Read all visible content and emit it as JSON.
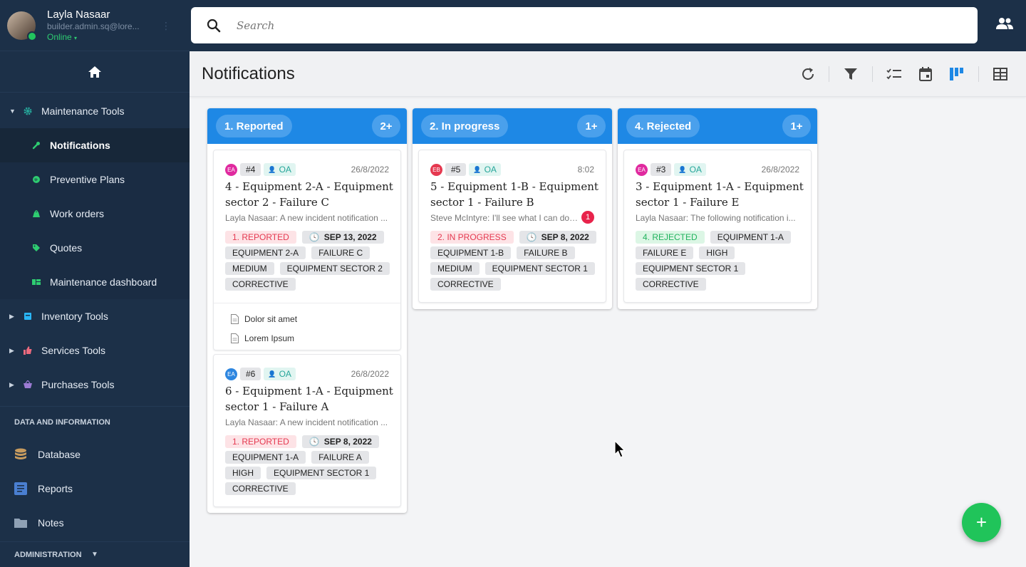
{
  "user": {
    "name": "Layla Nasaar",
    "email": "builder.admin.sq@lore...",
    "status": "Online"
  },
  "search": {
    "placeholder": "Search"
  },
  "sidebar": {
    "groups": [
      {
        "label": "Maintenance Tools",
        "color": "#26a69a",
        "expanded": true,
        "items": [
          {
            "label": "Notifications",
            "icon": "wrench-icon",
            "color": "#2ecc71",
            "active": true
          },
          {
            "label": "Preventive Plans",
            "icon": "globe-icon",
            "color": "#2ecc71"
          },
          {
            "label": "Work orders",
            "icon": "bag-icon",
            "color": "#2ecc71"
          },
          {
            "label": "Quotes",
            "icon": "tag-icon",
            "color": "#2ecc71"
          },
          {
            "label": "Maintenance dashboard",
            "icon": "dashboard-icon",
            "color": "#2ecc71"
          }
        ]
      },
      {
        "label": "Inventory Tools",
        "color": "#29b6f6",
        "icon": "inventory-icon"
      },
      {
        "label": "Services Tools",
        "color": "#ec6a7e",
        "icon": "thumb-icon"
      },
      {
        "label": "Purchases Tools",
        "color": "#9c7bd4",
        "icon": "basket-icon"
      }
    ],
    "section_title": "DATA AND INFORMATION",
    "data_items": [
      {
        "label": "Database",
        "icon": "database-icon",
        "color": "#c79b5e"
      },
      {
        "label": "Reports",
        "icon": "reports-icon",
        "color": "#4a7fd1"
      },
      {
        "label": "Notes",
        "icon": "folder-icon",
        "color": "#8fa1b5"
      }
    ],
    "admin_title": "ADMINISTRATION"
  },
  "header": {
    "title": "Notifications",
    "view_active": "kanban"
  },
  "board": {
    "columns": [
      {
        "title": "1. Reported",
        "count": "2+",
        "cards": [
          {
            "initials": "EA",
            "initials_color": "#e02a9f",
            "id": "#4",
            "assignee": "OA",
            "date": "26/8/2022",
            "title": "4 - Equipment 2-A - Equipment sector 2 - Failure C",
            "preview": "Layla Nasaar: A new incident notification ...",
            "status": "1. REPORTED",
            "due": "SEP 13, 2022",
            "tags": [
              "EQUIPMENT 2-A",
              "FAILURE C",
              "MEDIUM",
              "EQUIPMENT SECTOR 2",
              "CORRECTIVE"
            ],
            "attachments": [
              "Dolor sit amet",
              "Lorem Ipsum"
            ]
          },
          {
            "initials": "EA",
            "initials_color": "#2d86e0",
            "id": "#6",
            "assignee": "OA",
            "date": "26/8/2022",
            "title": "6 - Equipment 1-A - Equipment sector 1 - Failure A",
            "preview": "Layla Nasaar: A new incident notification ...",
            "status": "1. REPORTED",
            "due": "SEP 8, 2022",
            "tags": [
              "EQUIPMENT 1-A",
              "FAILURE A",
              "HIGH",
              "EQUIPMENT SECTOR 1",
              "CORRECTIVE"
            ]
          }
        ]
      },
      {
        "title": "2. In progress",
        "count": "1+",
        "cards": [
          {
            "initials": "EB",
            "initials_color": "#e53950",
            "id": "#5",
            "assignee": "OA",
            "date": "8:02",
            "title": "5 - Equipment 1-B - Equipment sector 1 - Failure B",
            "preview": "Steve McIntyre: I'll see what I can do. ...",
            "unread": "1",
            "status": "2. IN PROGRESS",
            "due": "SEP 8, 2022",
            "tags": [
              "EQUIPMENT 1-B",
              "FAILURE B",
              "MEDIUM",
              "EQUIPMENT SECTOR 1",
              "CORRECTIVE"
            ]
          }
        ]
      },
      {
        "title": "4. Rejected",
        "count": "1+",
        "cards": [
          {
            "initials": "EA",
            "initials_color": "#e02a9f",
            "id": "#3",
            "assignee": "OA",
            "date": "26/8/2022",
            "title": "3 - Equipment 1-A - Equipment sector 1 - Failure E",
            "preview": "Layla Nasaar: The following notification i...",
            "status": "4. REJECTED",
            "tags": [
              "EQUIPMENT 1-A",
              "FAILURE E",
              "HIGH",
              "EQUIPMENT SECTOR 1",
              "CORRECTIVE"
            ]
          }
        ]
      }
    ]
  },
  "fab": {
    "label": "+"
  }
}
